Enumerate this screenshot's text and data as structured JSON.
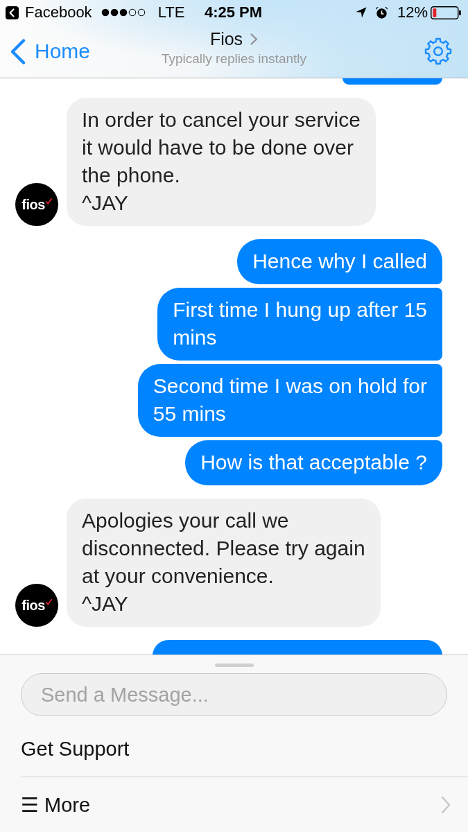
{
  "status_bar": {
    "back_app": "Facebook",
    "network": "LTE",
    "time": "4:25 PM",
    "battery": "12%"
  },
  "nav": {
    "back": "Home",
    "title": "Fios",
    "subtitle": "Typically replies instantly"
  },
  "messages": [
    {
      "kind": "sent_cut_top"
    },
    {
      "kind": "received",
      "text": "In order to cancel your service\nit would have to be done over\nthe phone.\n^JAY",
      "avatar": "fios"
    },
    {
      "kind": "sent",
      "text": "Hence why I called"
    },
    {
      "kind": "sent",
      "text": "First time I hung up after 15\nmins"
    },
    {
      "kind": "sent",
      "text": "Second time I was on hold for\n55 mins"
    },
    {
      "kind": "sent",
      "text": "How is that acceptable ?"
    },
    {
      "kind": "received",
      "text": "Apologies your call we\ndisconnected. Please try again\nat your convenience.\n^JAY",
      "avatar": "fios"
    },
    {
      "kind": "sent_cut_bottom"
    }
  ],
  "composer": {
    "placeholder": "Send a Message..."
  },
  "menu": [
    {
      "label": "Get Support",
      "submenu": false
    },
    {
      "label": "☰ More",
      "submenu": true
    }
  ]
}
